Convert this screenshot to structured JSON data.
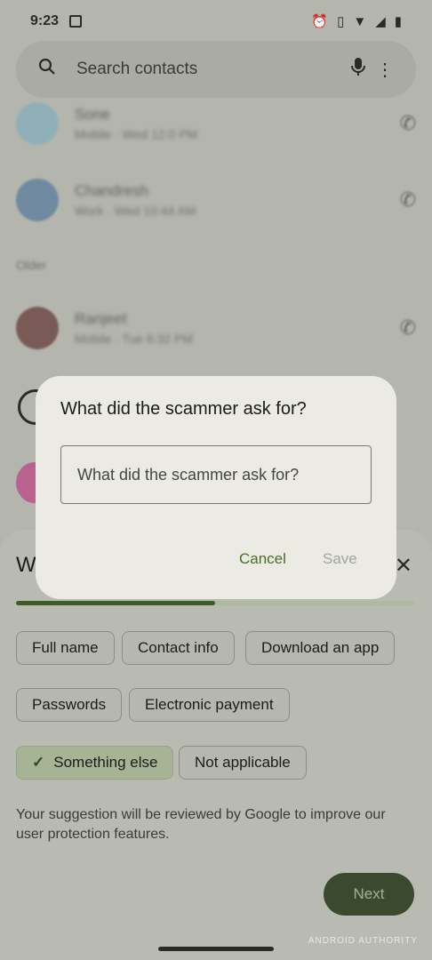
{
  "status_bar": {
    "time": "9:23",
    "icons": [
      "alarm-icon",
      "vibrate-icon",
      "wifi-icon",
      "signal-icon",
      "battery-icon"
    ]
  },
  "search": {
    "placeholder": "Search contacts",
    "icons": [
      "search-icon",
      "mic-icon",
      "more-vert-icon"
    ]
  },
  "background_list": {
    "items": [
      {
        "name": "Sone",
        "sub": "Mobile · Wed 12:0 PM"
      },
      {
        "name": "Chandresh",
        "sub": "Work · Wed 10:44 AM"
      },
      {
        "name": "Ranjeet",
        "sub": "Mobile · Tue 6:32 PM"
      }
    ],
    "section_label": "Older"
  },
  "sheet": {
    "title_initial": "W",
    "progress": 0.5,
    "chips": [
      {
        "label": "Full name",
        "selected": false
      },
      {
        "label": "Contact info",
        "selected": false
      },
      {
        "label": "Download an app",
        "selected": false
      },
      {
        "label": "Passwords",
        "selected": false
      },
      {
        "label": "Electronic payment",
        "selected": false
      },
      {
        "label": "Something else",
        "selected": true
      },
      {
        "label": "Not applicable",
        "selected": false
      }
    ],
    "disclaimer": "Your suggestion will be reviewed by Google to improve our user protection features.",
    "next_label": "Next"
  },
  "dialog": {
    "title": "What did the scammer ask for?",
    "input_placeholder": "What did the scammer ask for?",
    "input_value": "",
    "cancel_label": "Cancel",
    "save_label": "Save"
  },
  "watermark": "ANDROID AUTHORITY",
  "colors": {
    "accent": "#4a6e2a",
    "next_button": "#3b4a2e",
    "dialog_bg": "#ebebe3"
  }
}
